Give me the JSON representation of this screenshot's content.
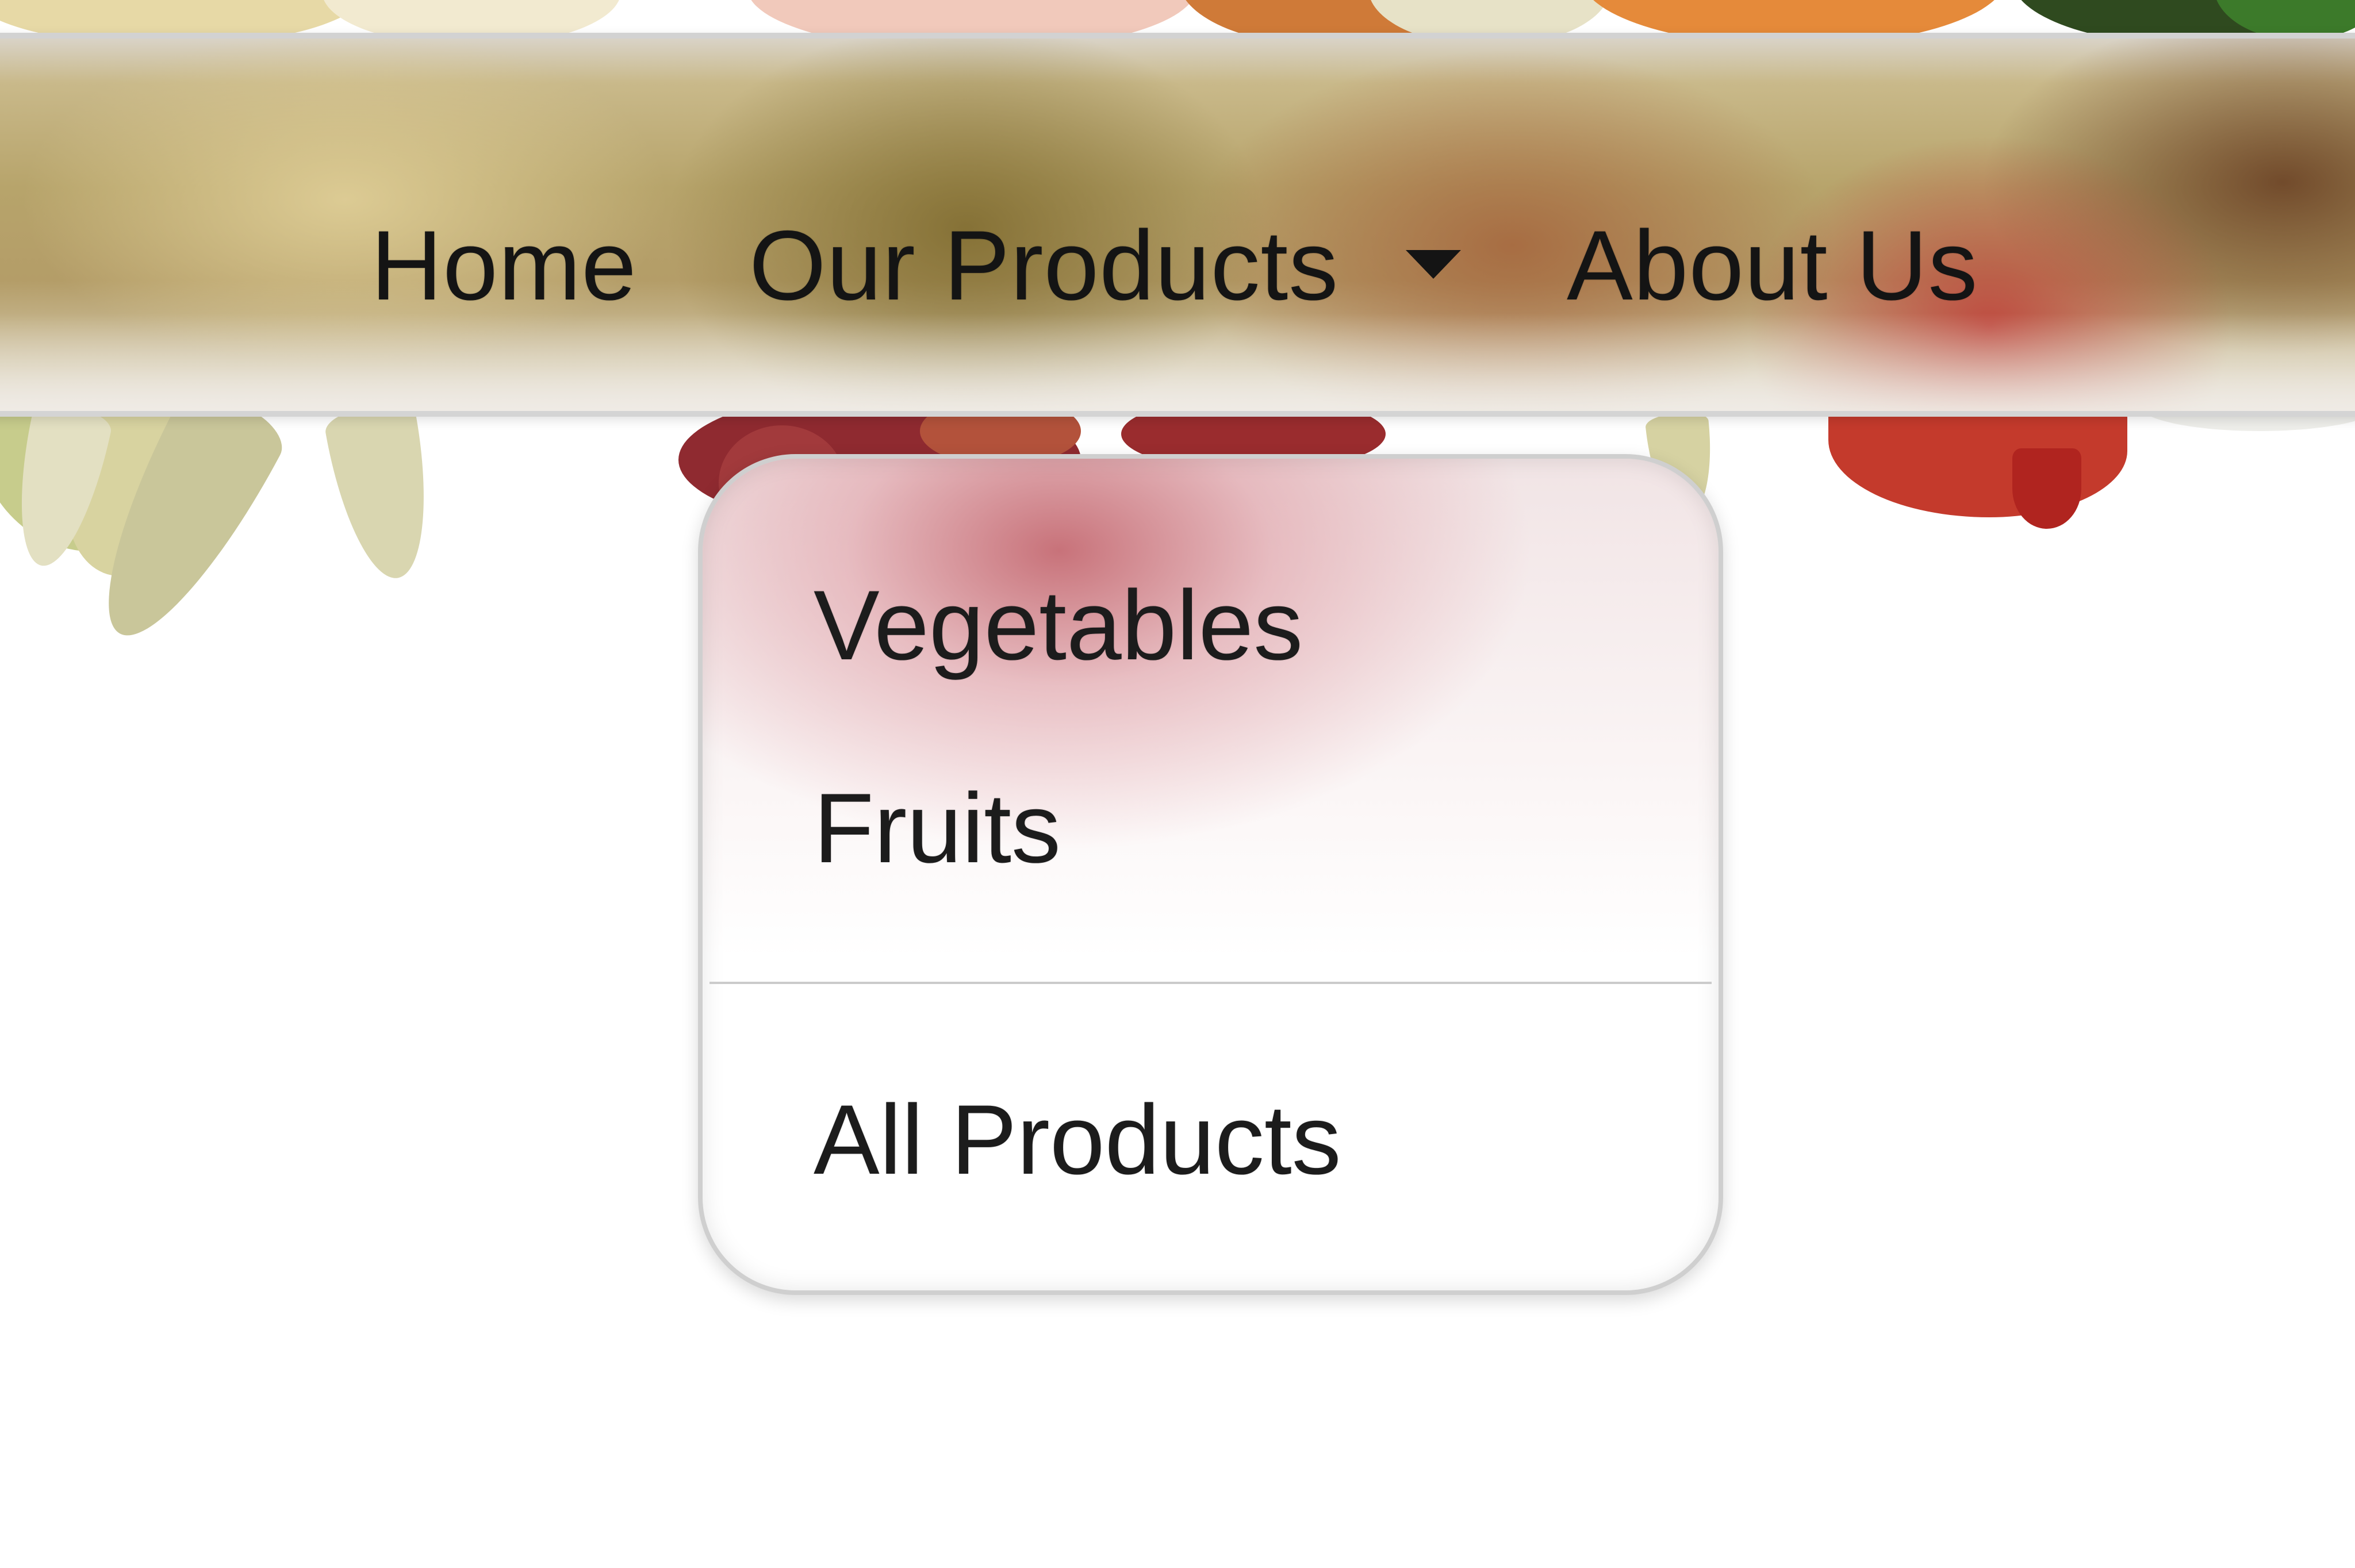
{
  "navbar": {
    "items": [
      {
        "label": "Home"
      },
      {
        "label": "Our Products",
        "has_dropdown": true,
        "dropdown_icon": "caret-down-icon"
      },
      {
        "label": "About Us"
      }
    ]
  },
  "dropdown": {
    "items": [
      {
        "label": "Vegetables"
      },
      {
        "label": "Fruits"
      }
    ],
    "footer_item": {
      "label": "All Products"
    }
  },
  "colors": {
    "text": "#141414",
    "menu_border": "#cfcfcf",
    "divider": "#cbcbcb"
  }
}
